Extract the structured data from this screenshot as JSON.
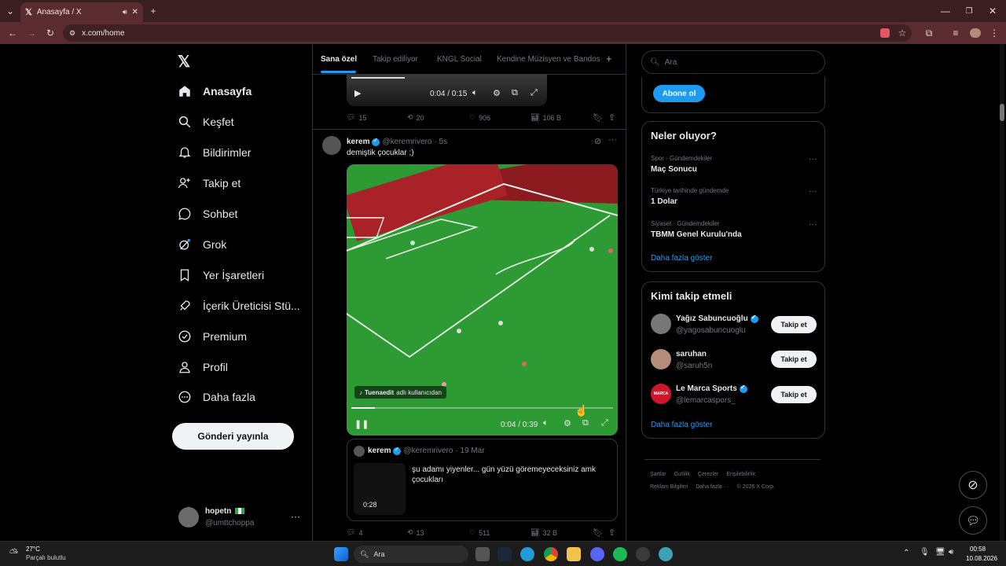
{
  "browser": {
    "tab_title": "Anasayfa / X",
    "url": "x.com/home"
  },
  "nav": {
    "items": [
      {
        "label": "Anasayfa",
        "icon": "home-icon"
      },
      {
        "label": "Keşfet",
        "icon": "search-icon"
      },
      {
        "label": "Bildirimler",
        "icon": "bell-icon"
      },
      {
        "label": "Takip et",
        "icon": "add-person-icon"
      },
      {
        "label": "Sohbet",
        "icon": "chat-icon"
      },
      {
        "label": "Grok",
        "icon": "grok-icon"
      },
      {
        "label": "Yer İşaretleri",
        "icon": "bookmark-icon"
      },
      {
        "label": "İçerik Üreticisi Stü...",
        "icon": "rocket-icon"
      },
      {
        "label": "Premium",
        "icon": "premium-icon"
      },
      {
        "label": "Profil",
        "icon": "person-icon"
      },
      {
        "label": "Daha fazla",
        "icon": "more-circle-icon"
      }
    ],
    "post_button": "Gönderi yayınla",
    "account": {
      "name": "hopetn",
      "handle": "@umttchoppa"
    }
  },
  "timeline": {
    "tabs": [
      "Sana özel",
      "Takip ediliyor",
      "KNGL Social",
      "Kendine Müzisyen ve Bandos"
    ],
    "prev_post": {
      "video_time": "0:04 / 0:15",
      "replies": "15",
      "reposts": "20",
      "likes": "906",
      "views": "106 B"
    },
    "post": {
      "name": "kerem",
      "handle": "@keremrivero",
      "time": "· 5s",
      "text": "demiştik çocuklar ;)",
      "video_time": "0:04 / 0:39",
      "video_credit_user": "Tuenaedit",
      "video_credit_suffix": "adlı kullanıcıdan",
      "progress": 0.09,
      "quote": {
        "name": "kerem",
        "handle": "@keremrivero",
        "date": "· 19 Mar",
        "text": "şu adamı yiyenler... gün yüzü göremeyeceksiniz amk çocukları",
        "duration": "0:28"
      },
      "replies": "4",
      "reposts": "13",
      "likes": "511",
      "views": "32 B"
    }
  },
  "sidebar": {
    "search_placeholder": "Ara",
    "subscribe_button": "Abone ol",
    "trends_title": "Neler oluyor?",
    "trends": [
      {
        "meta": "Spor · Gündemdekiler",
        "name": "Maç Sonucu"
      },
      {
        "meta": "Türkiye tarihinde gündemde",
        "name": "1 Dolar"
      },
      {
        "meta": "Siyaset · Gündemdekiler",
        "name": "TBMM Genel Kurulu'nda"
      }
    ],
    "trends_more": "Daha fazla göster",
    "who_title": "Kimi takip etmeli",
    "who": [
      {
        "name": "Yağız Sabuncuoğlu",
        "handle": "@yagosabuncuoglu",
        "verified": true,
        "button": "Takip et"
      },
      {
        "name": "saruhan",
        "handle": "@saruh5n",
        "verified": false,
        "button": "Takip et"
      },
      {
        "name": "Le Marca Sports",
        "handle": "@lemarcaspors_",
        "verified": true,
        "button": "Takip et"
      }
    ],
    "who_more": "Daha fazla göster",
    "footer": [
      "Şartlar",
      "Gizlilik",
      "Çerezler",
      "Erişilebilirlik",
      "Reklam Bilgileri",
      "Daha fazla ···",
      "© 2026 X Corp."
    ]
  },
  "taskbar": {
    "weather_temp": "27°C",
    "weather_desc": "Parçalı bulutlu",
    "search_label": "Ara",
    "time": "00:58",
    "date": "10.08.2026"
  },
  "colors": {
    "accent": "#1d9bf0",
    "chrome": "#5a2c2f",
    "pitch": "#2f9e2f"
  }
}
